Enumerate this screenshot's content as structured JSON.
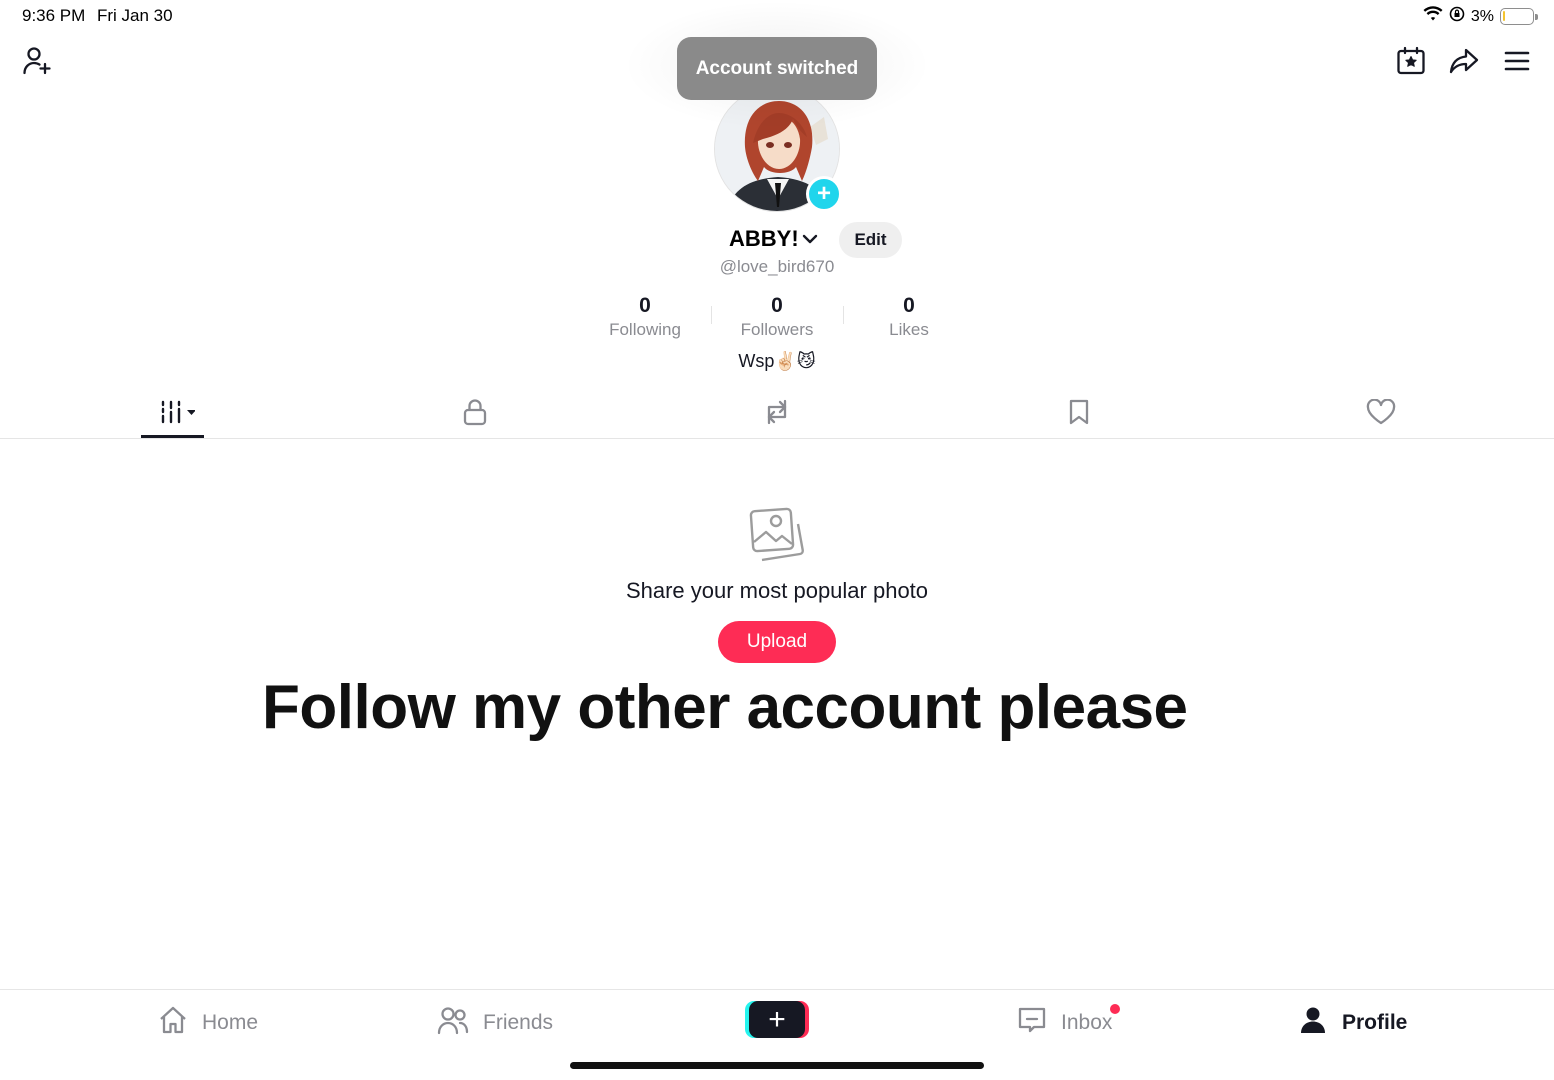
{
  "status_bar": {
    "time": "9:36 PM",
    "date": "Fri Jan 30",
    "battery_percent": "3%",
    "battery_level": 0.03
  },
  "toast": {
    "text": "Account switched"
  },
  "profile": {
    "display_name": "ABBY!",
    "username": "@love_bird670",
    "edit_label": "Edit",
    "bio": "Wsp✌🏻😼",
    "stats": [
      {
        "value": "0",
        "label": "Following"
      },
      {
        "value": "0",
        "label": "Followers"
      },
      {
        "value": "0",
        "label": "Likes"
      }
    ]
  },
  "tabs": [
    {
      "icon": "videos-grid-icon",
      "active": true
    },
    {
      "icon": "lock-icon",
      "active": false
    },
    {
      "icon": "repost-icon",
      "active": false
    },
    {
      "icon": "bookmark-icon",
      "active": false
    },
    {
      "icon": "heart-icon",
      "active": false
    }
  ],
  "empty_state": {
    "title": "Share your most popular photo",
    "button_label": "Upload",
    "icon": "photos-icon"
  },
  "overlay_text": "Follow my other account please",
  "bottom_nav": {
    "home": "Home",
    "friends": "Friends",
    "create": "+",
    "inbox": "Inbox",
    "profile": "Profile"
  },
  "colors": {
    "accent": "#fe2c55",
    "cyan": "#25f4ee",
    "avatar_badge": "#20d5ec",
    "toast_bg": "#8a8a8a"
  }
}
